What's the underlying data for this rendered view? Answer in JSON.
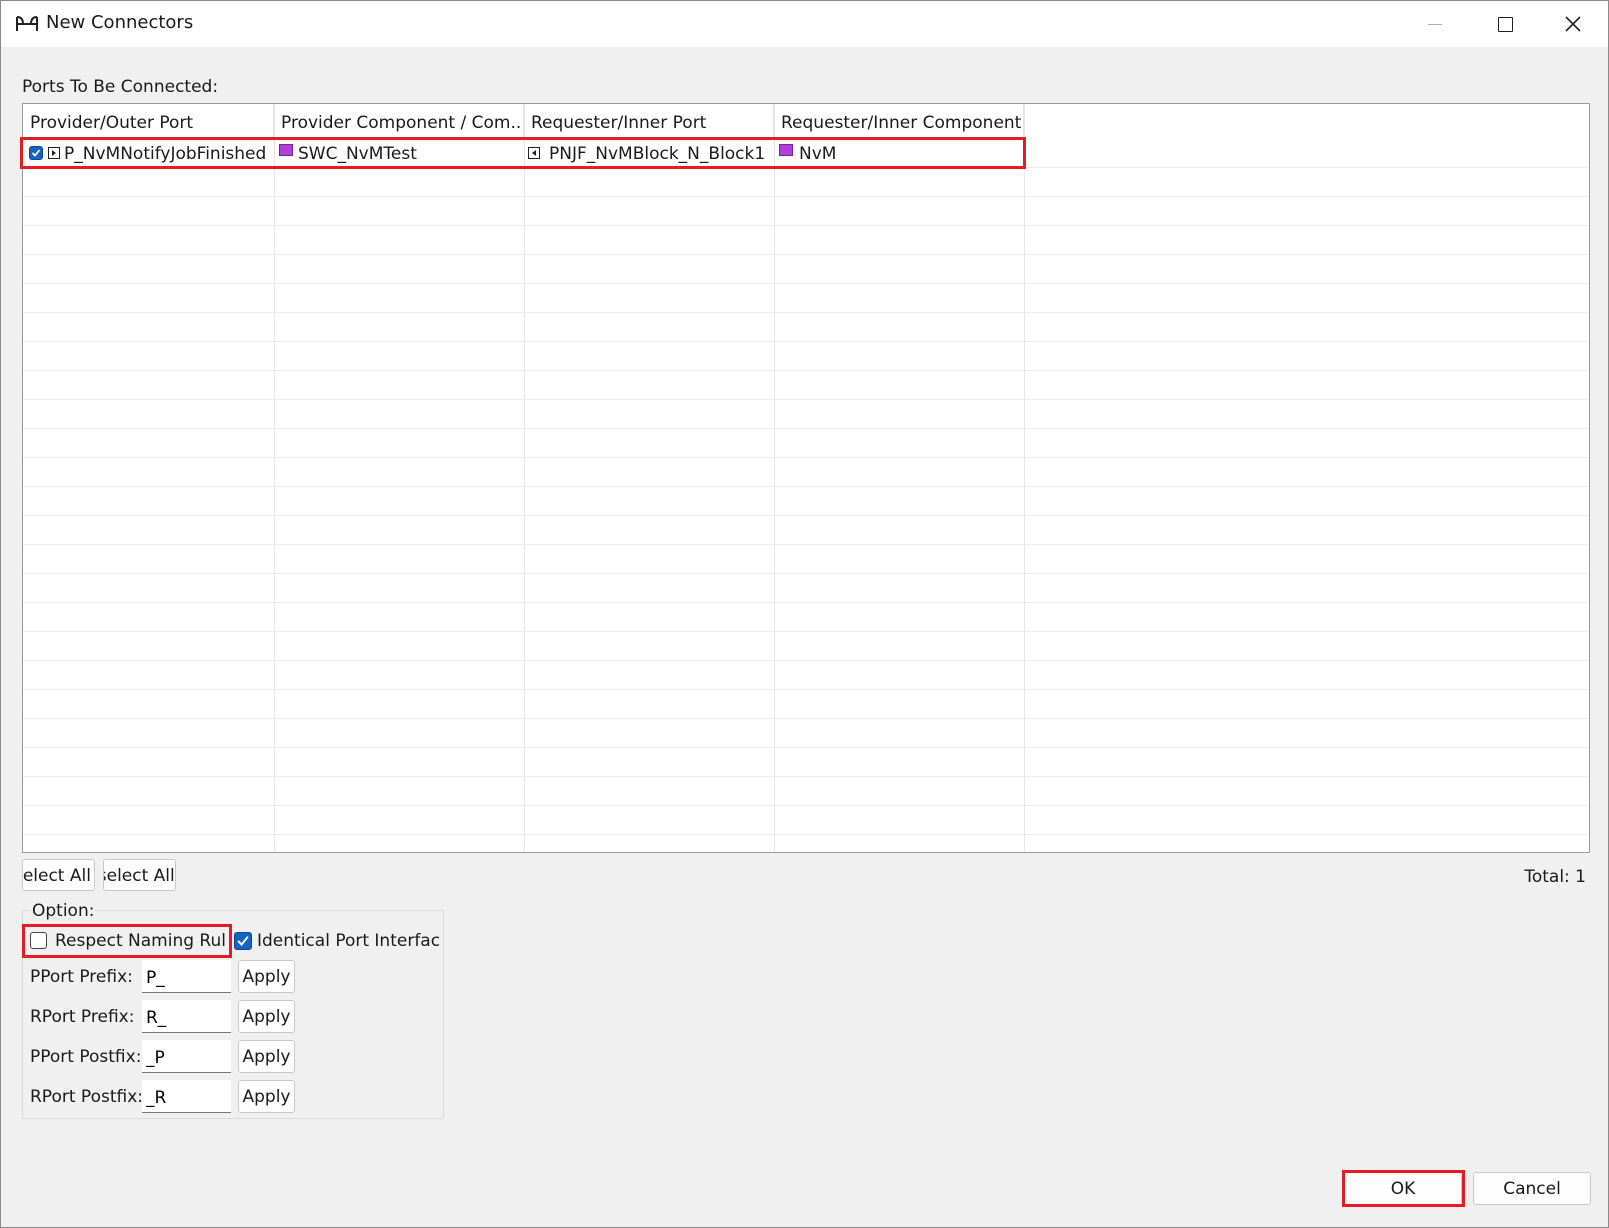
{
  "window": {
    "title": "New Connectors",
    "icon": "connector-icon"
  },
  "ports_label": "Ports To Be Connected:",
  "table": {
    "columns": [
      "Provider/Outer Port",
      "Provider Component / Com...",
      "Requester/Inner Port",
      "Requester/Inner Component"
    ],
    "rows": [
      {
        "checked": true,
        "provider_port": "P_NvMNotifyJobFinished",
        "provider_component": "SWC_NvMTest",
        "requester_port": "PNJF_NvMBlock_N_Block1",
        "requester_component": "NvM"
      }
    ]
  },
  "buttons": {
    "select_all": "Select All",
    "deselect_all": "Deselect All",
    "ok": "OK",
    "cancel": "Cancel"
  },
  "total": "Total: 1",
  "option": {
    "label": "Option:",
    "respect_naming_rule": {
      "label": "Respect Naming Rule",
      "checked": false
    },
    "identical_port_interface": {
      "label": "Identical Port Interface",
      "checked": true
    },
    "fields": [
      {
        "label": "PPort Prefix:",
        "value": "P_",
        "apply": "Apply"
      },
      {
        "label": "RPort Prefix:",
        "value": "R_",
        "apply": "Apply"
      },
      {
        "label": "PPort Postfix:",
        "value": "_P",
        "apply": "Apply"
      },
      {
        "label": "RPort Postfix:",
        "value": "_R",
        "apply": "Apply"
      }
    ]
  },
  "colors": {
    "highlight": "#e01e24",
    "checkbox": "#1565c0",
    "component_icon": "#b040d8"
  }
}
